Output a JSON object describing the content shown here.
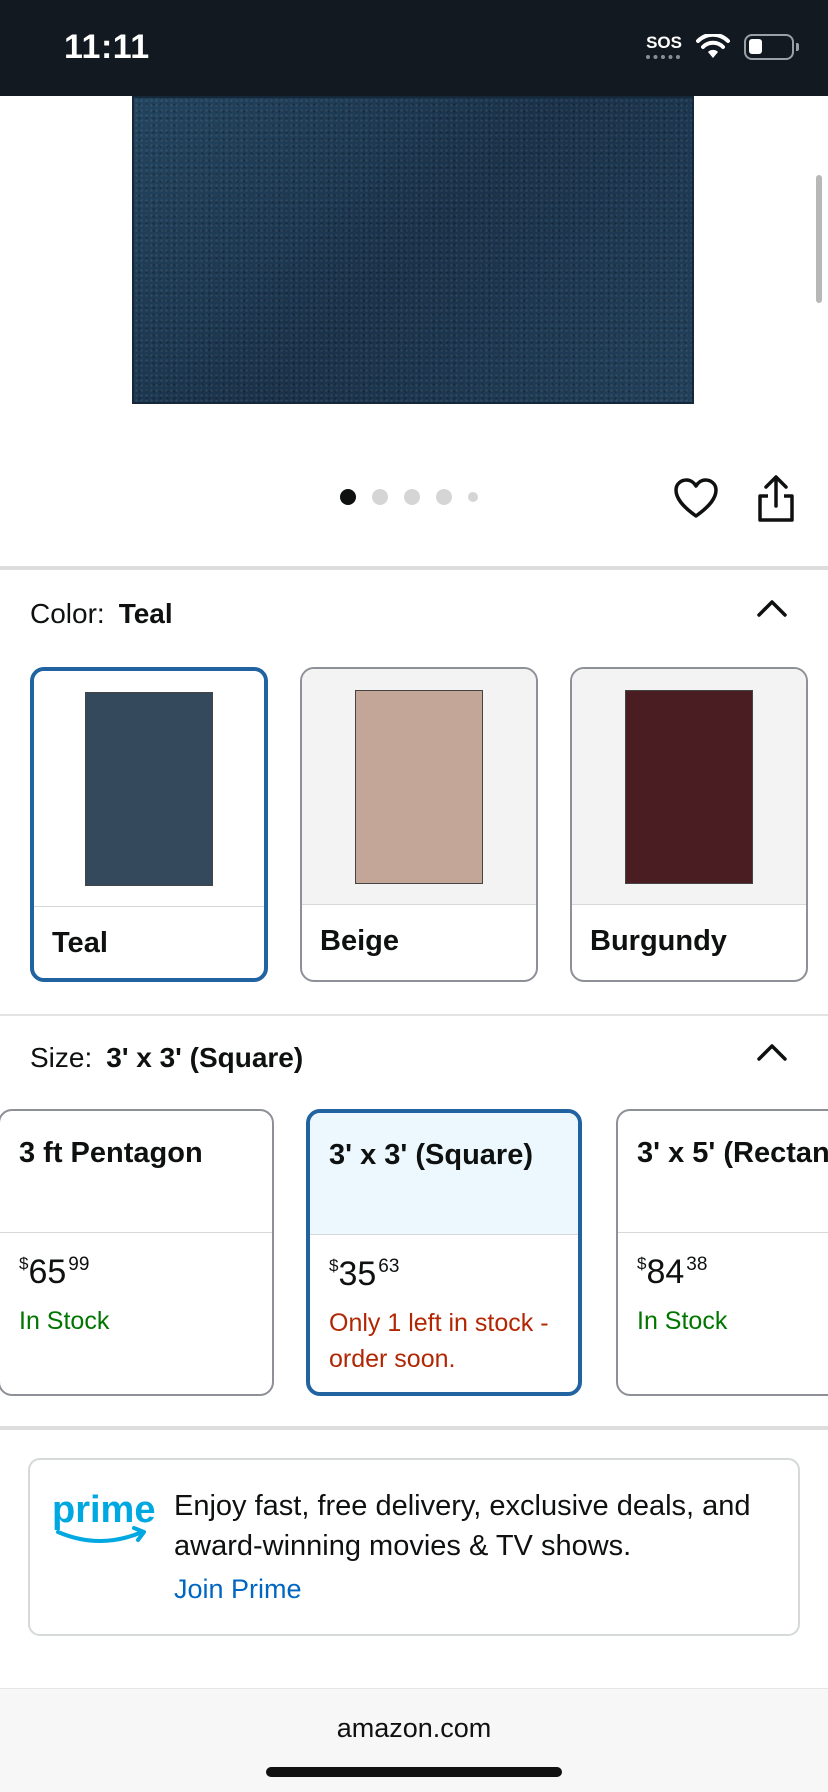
{
  "status_bar": {
    "time": "11:11",
    "sos": "SOS"
  },
  "carousel": {
    "dot_count": 5,
    "active_index": 0
  },
  "color": {
    "label": "Color:",
    "selected": "Teal",
    "options": [
      {
        "name": "Teal",
        "rug_color": "#34495c",
        "selected": true
      },
      {
        "name": "Beige",
        "rug_color": "#c4a699",
        "selected": false
      },
      {
        "name": "Burgundy",
        "rug_color": "#4a1d22",
        "selected": false
      }
    ]
  },
  "size": {
    "label": "Size:",
    "selected": "3' x 3' (Square)",
    "options": [
      {
        "name": "3 ft Pentagon",
        "price_symbol": "$",
        "price_whole": "65",
        "price_cents": "99",
        "stock": "In Stock",
        "stock_status": "in_stock"
      },
      {
        "name": "3' x 3' (Square)",
        "price_symbol": "$",
        "price_whole": "35",
        "price_cents": "63",
        "stock": "Only 1 left in stock - order soon.",
        "stock_status": "low"
      },
      {
        "name": "3' x 5' (Rectan",
        "price_symbol": "$",
        "price_whole": "84",
        "price_cents": "38",
        "stock": "In Stock",
        "stock_status": "in_stock"
      }
    ]
  },
  "prime": {
    "logo_text": "prime",
    "message": "Enjoy fast, free delivery, exclusive deals, and award-winning movies & TV shows.",
    "link": "Join Prime"
  },
  "url_bar": {
    "domain": "amazon.com"
  },
  "colors": {
    "accent": "#2162a1",
    "prime_blue": "#00a8e1",
    "in_stock": "#007600",
    "low_stock": "#b12704",
    "link": "#0066c0"
  }
}
